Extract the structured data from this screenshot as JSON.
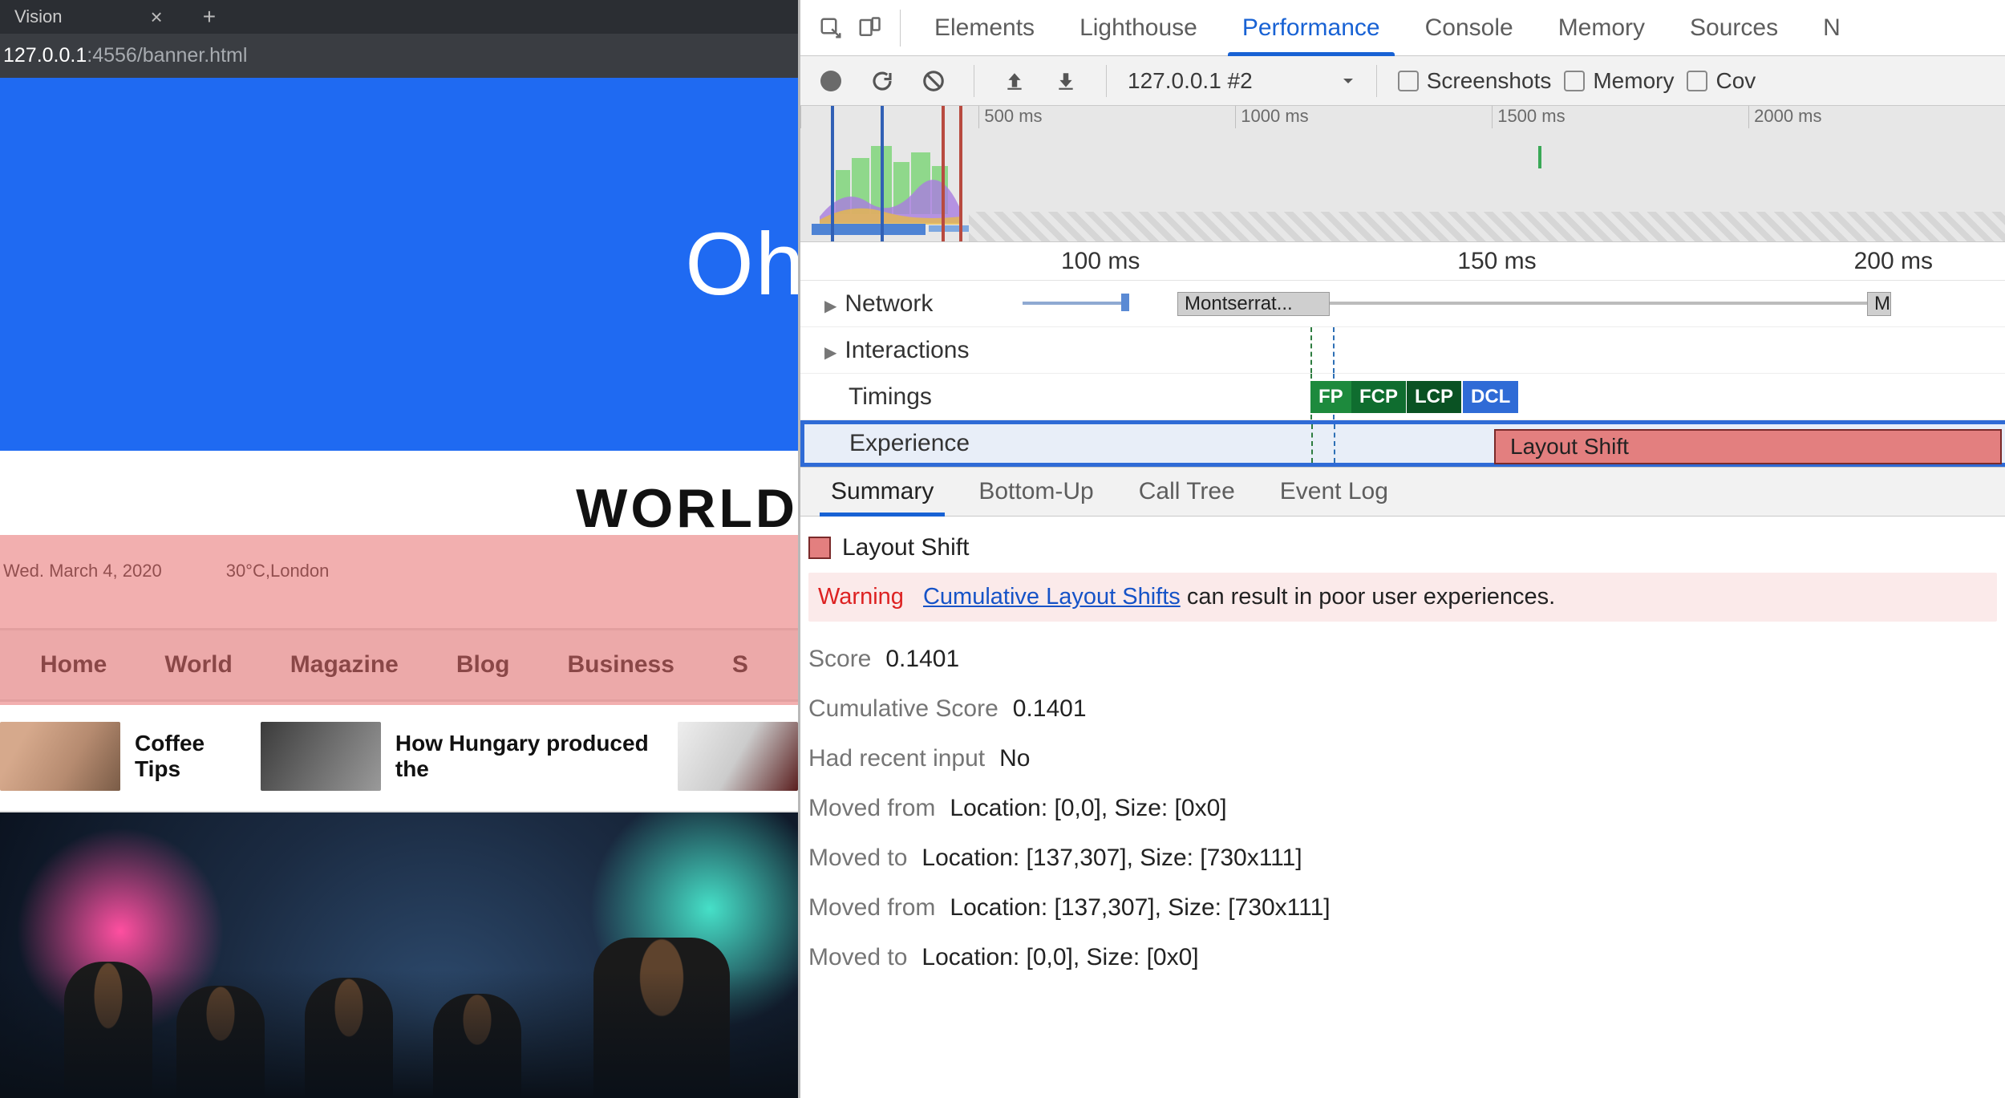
{
  "browser": {
    "tab_title": "Vision",
    "url_host": "127.0.0.1",
    "url_port_path": ":4556/banner.html"
  },
  "page": {
    "banner_text": "Oh",
    "date": "Wed. March 4, 2020",
    "weather": "30°C,London",
    "site_title": "WORLD",
    "nav": [
      "Home",
      "World",
      "Magazine",
      "Blog",
      "Business",
      "S"
    ],
    "featured": [
      {
        "title": "Coffee Tips"
      },
      {
        "title": "How Hungary produced the"
      }
    ]
  },
  "devtools": {
    "tabs": [
      "Elements",
      "Lighthouse",
      "Performance",
      "Console",
      "Memory",
      "Sources",
      "N"
    ],
    "active_tab": "Performance",
    "toolbar": {
      "session": "127.0.0.1 #2",
      "checks": [
        "Screenshots",
        "Memory",
        "Cov"
      ]
    },
    "overview_ticks": [
      "500 ms",
      "1000 ms",
      "1500 ms",
      "2000 ms"
    ],
    "flame_ruler": [
      "100 ms",
      "150 ms",
      "200 ms"
    ],
    "tracks": {
      "network": "Network",
      "interactions": "Interactions",
      "timings": "Timings",
      "experience": "Experience",
      "net_span": "Montserrat...",
      "net_span_m": "M",
      "timing_pills": [
        "FP",
        "FCP",
        "LCP",
        "DCL"
      ],
      "ls_label": "Layout Shift"
    },
    "sub_tabs": [
      "Summary",
      "Bottom-Up",
      "Call Tree",
      "Event Log"
    ],
    "active_sub": "Summary",
    "summary": {
      "title": "Layout Shift",
      "warn_label": "Warning",
      "warn_link": "Cumulative Layout Shifts",
      "warn_rest": " can result in poor user experiences.",
      "rows": [
        {
          "k": "Score",
          "v": "0.1401"
        },
        {
          "k": "Cumulative Score",
          "v": "0.1401"
        },
        {
          "k": "Had recent input",
          "v": "No"
        },
        {
          "k": "Moved from",
          "v": "Location: [0,0], Size: [0x0]"
        },
        {
          "k": "Moved to",
          "v": "Location: [137,307], Size: [730x111]"
        },
        {
          "k": "Moved from",
          "v": "Location: [137,307], Size: [730x111]"
        },
        {
          "k": "Moved to",
          "v": "Location: [0,0], Size: [0x0]"
        }
      ]
    }
  }
}
